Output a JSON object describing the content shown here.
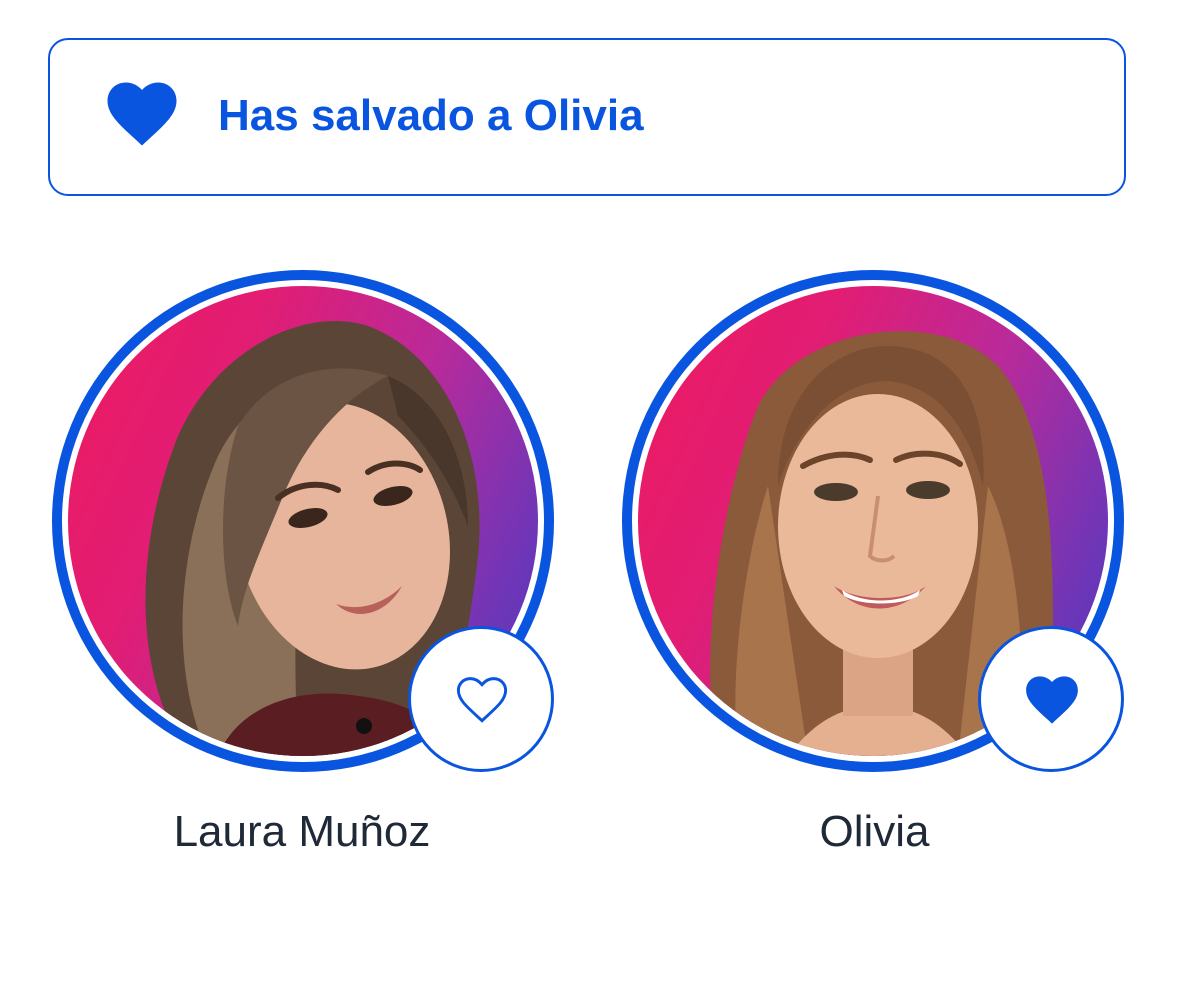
{
  "banner": {
    "icon": "heart-filled-icon",
    "message": "Has salvado a Olivia",
    "accent_color": "#0a55e0"
  },
  "contestants": [
    {
      "name": "Laura Muñoz",
      "vote_icon": "heart-outline-icon",
      "saved": false
    },
    {
      "name": "Olivia",
      "vote_icon": "heart-filled-icon",
      "saved": true
    }
  ]
}
